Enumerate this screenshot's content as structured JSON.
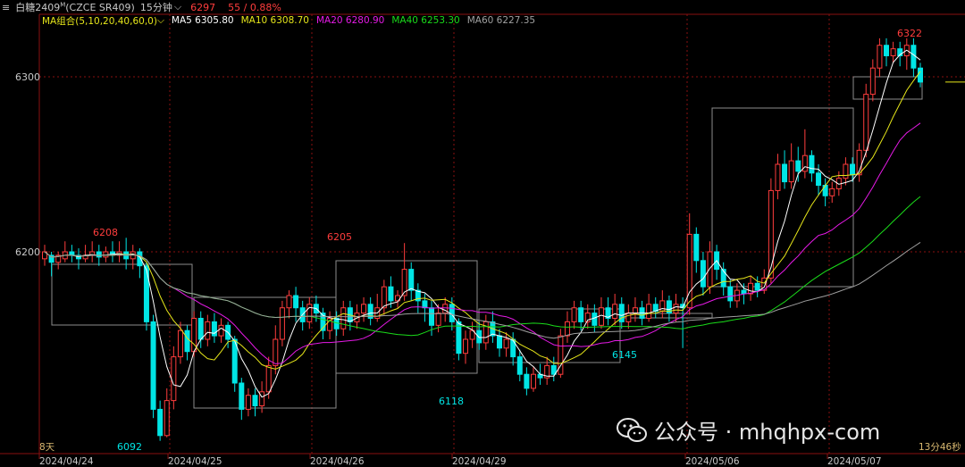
{
  "header": {
    "icon": "menu-icon",
    "title": "白糖2409",
    "title_sup": "M",
    "code": "(CZCE SR409)",
    "period": "15分钟",
    "price": "6297",
    "change": "55 / 0.88%"
  },
  "ma_bar": {
    "group_label": "MA组合(5,10,20,40,60,0)",
    "ma5": "MA5 6305.80",
    "ma10": "MA10 6308.70",
    "ma20": "MA20 6280.90",
    "ma40": "MA40 6253.30",
    "ma60": "MA60 6227.35"
  },
  "colors": {
    "up": "#ff3d3d",
    "down": "#00e5e5",
    "ma5": "#ffffff",
    "ma10": "#e6e61a",
    "ma20": "#e61ae6",
    "ma40": "#1adc1a",
    "ma60": "#a0a0a0"
  },
  "axis": {
    "y_labels": [
      "6300",
      "6200"
    ],
    "x_labels": [
      "2024/04/24",
      "2024/04/25",
      "2024/04/26",
      "2024/04/29",
      "2024/05/06",
      "2024/05/07"
    ]
  },
  "annotations": {
    "high1": "6208",
    "low1": "6092",
    "high2": "6205",
    "low2": "6118",
    "low3": "6145",
    "high3": "6322"
  },
  "footer": {
    "left": "8天",
    "right": "13分46秒"
  },
  "watermark": {
    "text": "公众号 · mhqhpx-com"
  },
  "chart_data": {
    "type": "candlestick",
    "ylim": [
      6080,
      6340
    ],
    "series": [
      {
        "name": "MA5",
        "values": [
          6305.8
        ]
      },
      {
        "name": "MA10",
        "values": [
          6308.7
        ]
      },
      {
        "name": "MA20",
        "values": [
          6280.9
        ]
      },
      {
        "name": "MA40",
        "values": [
          6253.3
        ]
      },
      {
        "name": "MA60",
        "values": [
          6227.35
        ]
      }
    ],
    "candles": [
      [
        6196,
        6200,
        6204,
        6192
      ],
      [
        6198,
        6194,
        6200,
        6186
      ],
      [
        6194,
        6198,
        6200,
        6190
      ],
      [
        6196,
        6200,
        6206,
        6194
      ],
      [
        6200,
        6198,
        6204,
        6194
      ],
      [
        6198,
        6196,
        6202,
        6190
      ],
      [
        6196,
        6198,
        6204,
        6194
      ],
      [
        6198,
        6200,
        6206,
        6194
      ],
      [
        6200,
        6197,
        6204,
        6192
      ],
      [
        6197,
        6200,
        6203,
        6194
      ],
      [
        6200,
        6198,
        6206,
        6194
      ],
      [
        6198,
        6200,
        6206,
        6194
      ],
      [
        6200,
        6196,
        6208,
        6190
      ],
      [
        6196,
        6200,
        6204,
        6190
      ],
      [
        6200,
        6192,
        6202,
        6185
      ],
      [
        6192,
        6160,
        6194,
        6155
      ],
      [
        6160,
        6110,
        6164,
        6105
      ],
      [
        6110,
        6095,
        6115,
        6092
      ],
      [
        6095,
        6115,
        6122,
        6094
      ],
      [
        6115,
        6140,
        6146,
        6110
      ],
      [
        6140,
        6155,
        6160,
        6136
      ],
      [
        6155,
        6143,
        6158,
        6138
      ],
      [
        6143,
        6162,
        6166,
        6140
      ],
      [
        6162,
        6150,
        6166,
        6145
      ],
      [
        6150,
        6160,
        6164,
        6146
      ],
      [
        6160,
        6152,
        6165,
        6148
      ],
      [
        6152,
        6158,
        6162,
        6148
      ],
      [
        6158,
        6150,
        6160,
        6145
      ],
      [
        6150,
        6125,
        6152,
        6120
      ],
      [
        6125,
        6110,
        6128,
        6104
      ],
      [
        6110,
        6118,
        6122,
        6106
      ],
      [
        6118,
        6112,
        6122,
        6106
      ],
      [
        6112,
        6120,
        6126,
        6108
      ],
      [
        6120,
        6135,
        6140,
        6116
      ],
      [
        6135,
        6150,
        6158,
        6130
      ],
      [
        6150,
        6168,
        6172,
        6146
      ],
      [
        6168,
        6175,
        6178,
        6162
      ],
      [
        6175,
        6168,
        6180,
        6160
      ],
      [
        6168,
        6160,
        6172,
        6155
      ],
      [
        6160,
        6170,
        6174,
        6156
      ],
      [
        6170,
        6165,
        6175,
        6160
      ],
      [
        6165,
        6155,
        6168,
        6150
      ],
      [
        6155,
        6162,
        6166,
        6150
      ],
      [
        6162,
        6156,
        6166,
        6152
      ],
      [
        6156,
        6168,
        6172,
        6152
      ],
      [
        6168,
        6160,
        6172,
        6155
      ],
      [
        6160,
        6165,
        6170,
        6156
      ],
      [
        6165,
        6170,
        6174,
        6160
      ],
      [
        6170,
        6162,
        6174,
        6158
      ],
      [
        6162,
        6168,
        6176,
        6160
      ],
      [
        6168,
        6180,
        6184,
        6164
      ],
      [
        6180,
        6172,
        6186,
        6168
      ],
      [
        6172,
        6175,
        6178,
        6168
      ],
      [
        6175,
        6190,
        6205,
        6172
      ],
      [
        6190,
        6178,
        6194,
        6172
      ],
      [
        6178,
        6172,
        6182,
        6165
      ],
      [
        6172,
        6168,
        6176,
        6160
      ],
      [
        6168,
        6158,
        6172,
        6152
      ],
      [
        6158,
        6165,
        6170,
        6154
      ],
      [
        6165,
        6170,
        6174,
        6160
      ],
      [
        6170,
        6160,
        6174,
        6155
      ],
      [
        6160,
        6142,
        6162,
        6138
      ],
      [
        6142,
        6150,
        6155,
        6136
      ],
      [
        6150,
        6155,
        6160,
        6145
      ],
      [
        6155,
        6148,
        6160,
        6144
      ],
      [
        6148,
        6160,
        6164,
        6144
      ],
      [
        6160,
        6152,
        6166,
        6148
      ],
      [
        6152,
        6145,
        6156,
        6140
      ],
      [
        6145,
        6150,
        6154,
        6140
      ],
      [
        6150,
        6140,
        6154,
        6135
      ],
      [
        6140,
        6130,
        6144,
        6126
      ],
      [
        6130,
        6122,
        6134,
        6118
      ],
      [
        6122,
        6130,
        6134,
        6120
      ],
      [
        6130,
        6128,
        6136,
        6124
      ],
      [
        6128,
        6135,
        6140,
        6124
      ],
      [
        6135,
        6130,
        6140,
        6126
      ],
      [
        6130,
        6152,
        6156,
        6128
      ],
      [
        6152,
        6160,
        6166,
        6148
      ],
      [
        6160,
        6168,
        6172,
        6156
      ],
      [
        6168,
        6160,
        6172,
        6155
      ],
      [
        6160,
        6165,
        6170,
        6156
      ],
      [
        6165,
        6158,
        6170,
        6154
      ],
      [
        6158,
        6168,
        6174,
        6156
      ],
      [
        6168,
        6162,
        6174,
        6158
      ],
      [
        6162,
        6170,
        6176,
        6158
      ],
      [
        6170,
        6160,
        6174,
        6156
      ],
      [
        6160,
        6165,
        6170,
        6156
      ],
      [
        6165,
        6168,
        6174,
        6160
      ],
      [
        6168,
        6162,
        6172,
        6158
      ],
      [
        6162,
        6170,
        6176,
        6160
      ],
      [
        6170,
        6166,
        6174,
        6162
      ],
      [
        6166,
        6172,
        6178,
        6162
      ],
      [
        6172,
        6165,
        6175,
        6160
      ],
      [
        6165,
        6170,
        6176,
        6160
      ],
      [
        6170,
        6168,
        6174,
        6145
      ],
      [
        6168,
        6210,
        6222,
        6164
      ],
      [
        6210,
        6195,
        6214,
        6188
      ],
      [
        6195,
        6180,
        6200,
        6175
      ],
      [
        6180,
        6200,
        6206,
        6176
      ],
      [
        6200,
        6190,
        6204,
        6184
      ],
      [
        6190,
        6180,
        6194,
        6175
      ],
      [
        6180,
        6172,
        6184,
        6168
      ],
      [
        6172,
        6178,
        6182,
        6168
      ],
      [
        6178,
        6176,
        6182,
        6170
      ],
      [
        6176,
        6182,
        6186,
        6172
      ],
      [
        6182,
        6178,
        6186,
        6174
      ],
      [
        6178,
        6185,
        6190,
        6176
      ],
      [
        6185,
        6235,
        6242,
        6182
      ],
      [
        6235,
        6250,
        6256,
        6230
      ],
      [
        6250,
        6240,
        6258,
        6236
      ],
      [
        6240,
        6252,
        6262,
        6236
      ],
      [
        6252,
        6246,
        6260,
        6240
      ],
      [
        6246,
        6255,
        6270,
        6242
      ],
      [
        6255,
        6245,
        6258,
        6240
      ],
      [
        6245,
        6238,
        6250,
        6232
      ],
      [
        6238,
        6232,
        6242,
        6226
      ],
      [
        6232,
        6236,
        6240,
        6228
      ],
      [
        6236,
        6242,
        6246,
        6232
      ],
      [
        6242,
        6250,
        6254,
        6238
      ],
      [
        6250,
        6244,
        6254,
        6240
      ],
      [
        6244,
        6258,
        6262,
        6240
      ],
      [
        6258,
        6290,
        6296,
        6254
      ],
      [
        6290,
        6305,
        6310,
        6286
      ],
      [
        6305,
        6318,
        6322,
        6300
      ],
      [
        6318,
        6312,
        6322,
        6306
      ],
      [
        6312,
        6316,
        6320,
        6308
      ],
      [
        6316,
        6312,
        6320,
        6306
      ],
      [
        6312,
        6318,
        6322,
        6304
      ],
      [
        6318,
        6305,
        6322,
        6300
      ],
      [
        6305,
        6297,
        6308,
        6294
      ]
    ]
  }
}
